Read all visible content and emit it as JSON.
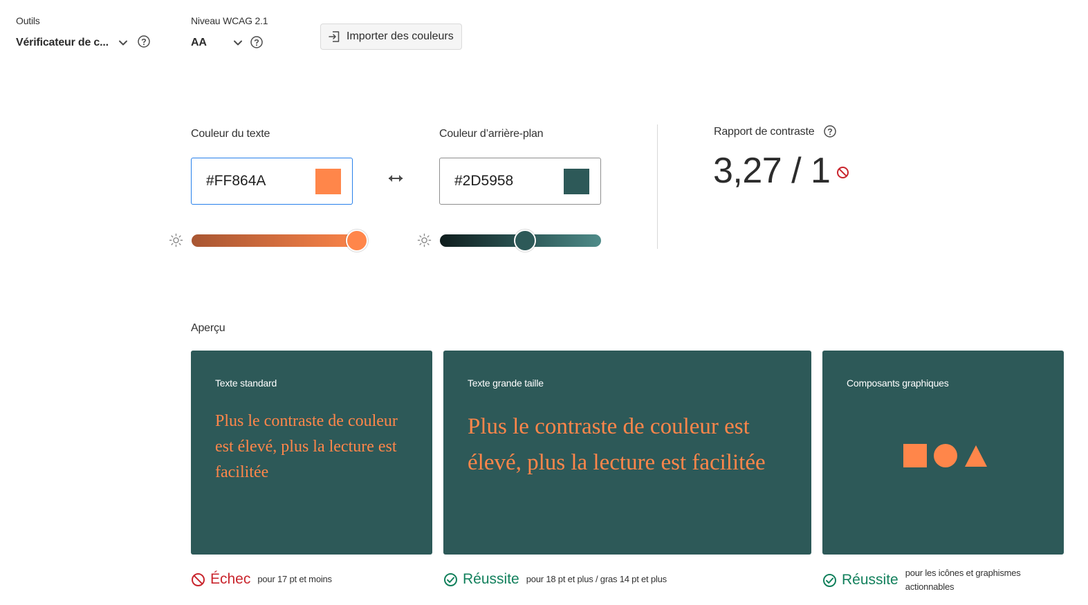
{
  "toolbar": {
    "tools_label": "Outils",
    "tools_value": "Vérificateur de c...",
    "wcag_label": "Niveau WCAG 2.1",
    "wcag_value": "AA",
    "import_label": "Importer des couleurs"
  },
  "colors": {
    "text_label": "Couleur du texte",
    "text_hex": "#FF864A",
    "bg_label": "Couleur d’arrière-plan",
    "bg_hex": "#2D5958",
    "text_brightness": 1.0,
    "bg_brightness": 0.53
  },
  "contrast": {
    "label": "Rapport de contraste",
    "value": "3,27 / 1",
    "status": "fail"
  },
  "preview": {
    "label": "Aperçu",
    "cards": [
      {
        "title": "Texte standard",
        "text": "Plus le contraste de couleur est élevé, plus la lecture est facilitée",
        "result": "Échec",
        "note": "pour 17 pt et moins"
      },
      {
        "title": "Texte grande taille",
        "text": "Plus le contraste de couleur est élevé, plus la lecture est facilitée",
        "result": "Réussite",
        "note": "pour 18 pt et plus / gras 14 pt et plus"
      },
      {
        "title": "Composants graphiques",
        "result": "Réussite",
        "note": "pour les icônes et graphismes actionnables"
      }
    ]
  },
  "palette": {
    "fail_red": "#c9252d",
    "pass_green": "#12805c",
    "accent_blue": "#2680eb",
    "text_color": "#FF864A",
    "bg_color": "#2D5958"
  },
  "icons": {
    "help": "question-circle-icon",
    "chevron": "chevron-down-icon",
    "import": "import-icon",
    "swap": "swap-arrows-icon",
    "brightness": "sun-icon",
    "fail": "no-entry-icon",
    "pass": "check-circle-icon"
  }
}
